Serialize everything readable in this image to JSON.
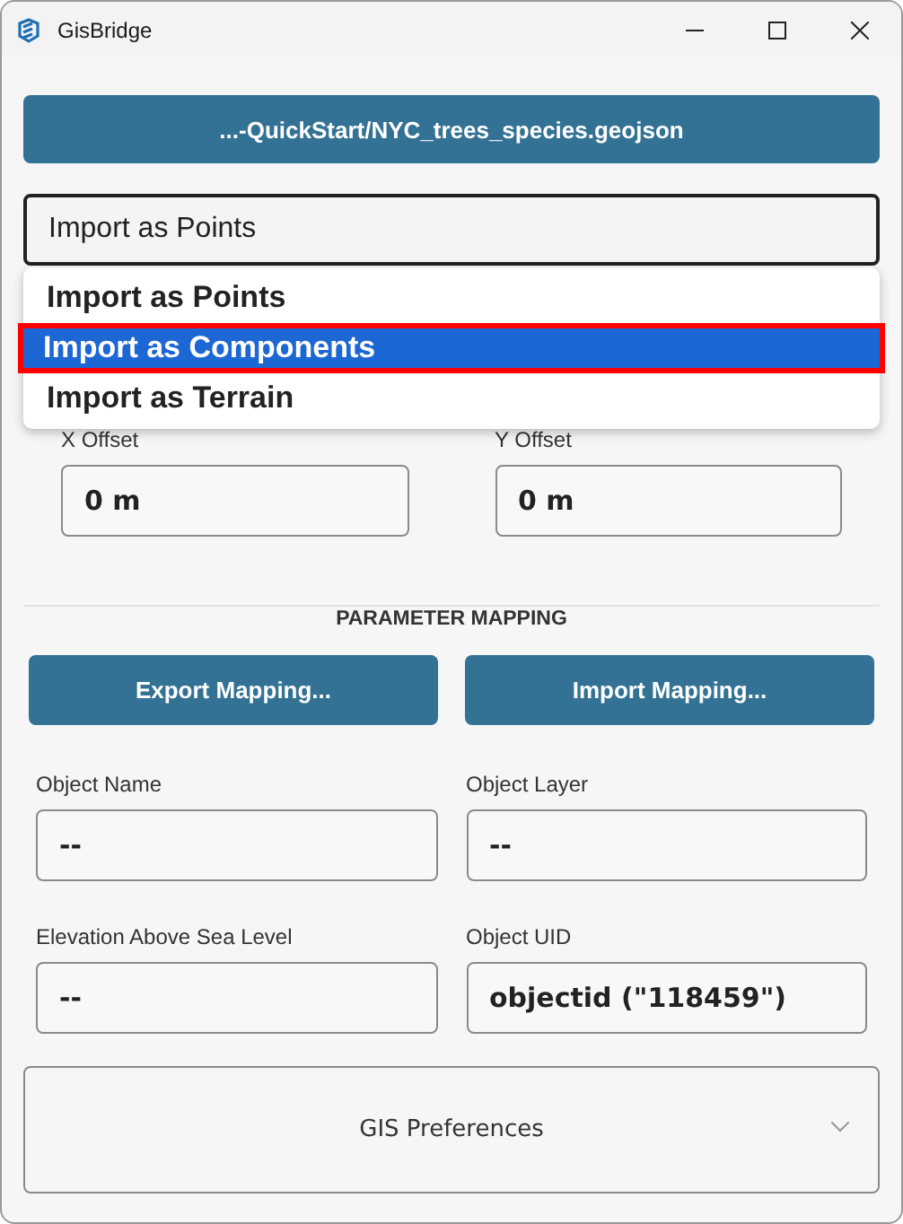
{
  "window": {
    "title": "GisBridge"
  },
  "file_button": {
    "label": "...-QuickStart/NYC_trees_species.geojson"
  },
  "import_select": {
    "value": "Import as Points",
    "expanded": true,
    "options": [
      {
        "label": "Import as Points",
        "highlighted": false
      },
      {
        "label": "Import as Components",
        "highlighted": true
      },
      {
        "label": "Import as Terrain",
        "highlighted": false
      }
    ]
  },
  "offsets": [
    {
      "label": "X Offset",
      "value": "0 m"
    },
    {
      "label": "Y Offset",
      "value": "0 m"
    }
  ],
  "parameter_mapping": {
    "heading": "PARAMETER MAPPING",
    "buttons": [
      "Export Mapping...",
      "Import Mapping..."
    ],
    "fields": [
      {
        "label": "Object Name",
        "value": "--"
      },
      {
        "label": "Object Layer",
        "value": "--"
      },
      {
        "label": "Elevation Above Sea Level",
        "value": "--"
      },
      {
        "label": "Object UID",
        "value": "objectid (\"118459\")"
      }
    ]
  },
  "preferences": {
    "label": "GIS Preferences",
    "expanded": false
  }
}
